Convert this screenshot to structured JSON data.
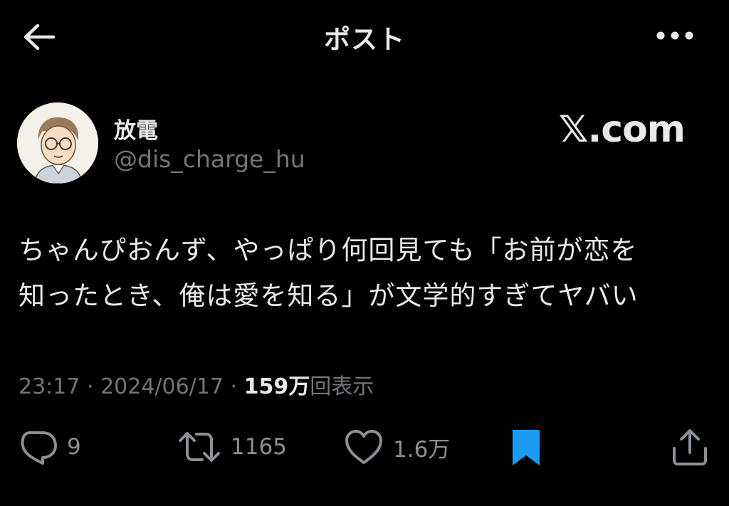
{
  "header": {
    "title": "ポスト"
  },
  "author": {
    "display_name": "放電",
    "handle": "@dis_charge_hu"
  },
  "watermark": "𝕏.com",
  "tweet": {
    "text_line1": "ちゃんぴおんず、やっぱり何回見ても「お前が恋を",
    "text_line2": "知ったとき、俺は愛を知る」が文学的すぎてヤバい"
  },
  "meta": {
    "time": "23:17",
    "separator": " · ",
    "date": "2024/06/17",
    "views_count": "159万",
    "views_label": "回表示"
  },
  "actions": {
    "replies": "9",
    "reposts": "1165",
    "likes": "1.6万"
  },
  "colors": {
    "background": "#000000",
    "text": "#e7e9ea",
    "muted": "#71767b",
    "bookmark_active": "#1d9bf0"
  },
  "icons": [
    "back-arrow-icon",
    "more-icon",
    "reply-icon",
    "repost-icon",
    "like-icon",
    "bookmark-icon",
    "share-icon"
  ]
}
